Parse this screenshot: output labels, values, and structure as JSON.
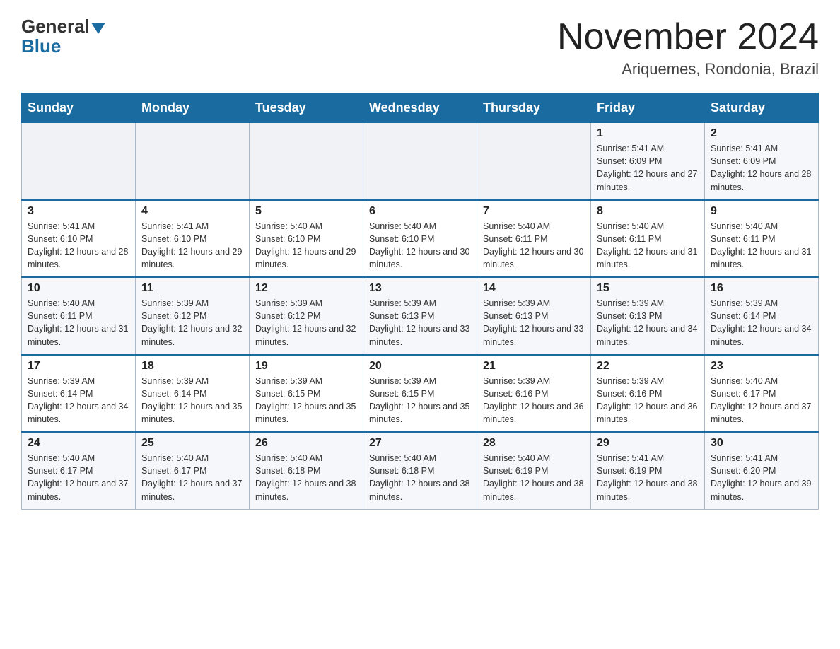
{
  "header": {
    "logo_general": "General",
    "logo_blue": "Blue",
    "title": "November 2024",
    "subtitle": "Ariquemes, Rondonia, Brazil"
  },
  "weekdays": [
    "Sunday",
    "Monday",
    "Tuesday",
    "Wednesday",
    "Thursday",
    "Friday",
    "Saturday"
  ],
  "weeks": [
    [
      {
        "day": "",
        "info": ""
      },
      {
        "day": "",
        "info": ""
      },
      {
        "day": "",
        "info": ""
      },
      {
        "day": "",
        "info": ""
      },
      {
        "day": "",
        "info": ""
      },
      {
        "day": "1",
        "info": "Sunrise: 5:41 AM\nSunset: 6:09 PM\nDaylight: 12 hours and 27 minutes."
      },
      {
        "day": "2",
        "info": "Sunrise: 5:41 AM\nSunset: 6:09 PM\nDaylight: 12 hours and 28 minutes."
      }
    ],
    [
      {
        "day": "3",
        "info": "Sunrise: 5:41 AM\nSunset: 6:10 PM\nDaylight: 12 hours and 28 minutes."
      },
      {
        "day": "4",
        "info": "Sunrise: 5:41 AM\nSunset: 6:10 PM\nDaylight: 12 hours and 29 minutes."
      },
      {
        "day": "5",
        "info": "Sunrise: 5:40 AM\nSunset: 6:10 PM\nDaylight: 12 hours and 29 minutes."
      },
      {
        "day": "6",
        "info": "Sunrise: 5:40 AM\nSunset: 6:10 PM\nDaylight: 12 hours and 30 minutes."
      },
      {
        "day": "7",
        "info": "Sunrise: 5:40 AM\nSunset: 6:11 PM\nDaylight: 12 hours and 30 minutes."
      },
      {
        "day": "8",
        "info": "Sunrise: 5:40 AM\nSunset: 6:11 PM\nDaylight: 12 hours and 31 minutes."
      },
      {
        "day": "9",
        "info": "Sunrise: 5:40 AM\nSunset: 6:11 PM\nDaylight: 12 hours and 31 minutes."
      }
    ],
    [
      {
        "day": "10",
        "info": "Sunrise: 5:40 AM\nSunset: 6:11 PM\nDaylight: 12 hours and 31 minutes."
      },
      {
        "day": "11",
        "info": "Sunrise: 5:39 AM\nSunset: 6:12 PM\nDaylight: 12 hours and 32 minutes."
      },
      {
        "day": "12",
        "info": "Sunrise: 5:39 AM\nSunset: 6:12 PM\nDaylight: 12 hours and 32 minutes."
      },
      {
        "day": "13",
        "info": "Sunrise: 5:39 AM\nSunset: 6:13 PM\nDaylight: 12 hours and 33 minutes."
      },
      {
        "day": "14",
        "info": "Sunrise: 5:39 AM\nSunset: 6:13 PM\nDaylight: 12 hours and 33 minutes."
      },
      {
        "day": "15",
        "info": "Sunrise: 5:39 AM\nSunset: 6:13 PM\nDaylight: 12 hours and 34 minutes."
      },
      {
        "day": "16",
        "info": "Sunrise: 5:39 AM\nSunset: 6:14 PM\nDaylight: 12 hours and 34 minutes."
      }
    ],
    [
      {
        "day": "17",
        "info": "Sunrise: 5:39 AM\nSunset: 6:14 PM\nDaylight: 12 hours and 34 minutes."
      },
      {
        "day": "18",
        "info": "Sunrise: 5:39 AM\nSunset: 6:14 PM\nDaylight: 12 hours and 35 minutes."
      },
      {
        "day": "19",
        "info": "Sunrise: 5:39 AM\nSunset: 6:15 PM\nDaylight: 12 hours and 35 minutes."
      },
      {
        "day": "20",
        "info": "Sunrise: 5:39 AM\nSunset: 6:15 PM\nDaylight: 12 hours and 35 minutes."
      },
      {
        "day": "21",
        "info": "Sunrise: 5:39 AM\nSunset: 6:16 PM\nDaylight: 12 hours and 36 minutes."
      },
      {
        "day": "22",
        "info": "Sunrise: 5:39 AM\nSunset: 6:16 PM\nDaylight: 12 hours and 36 minutes."
      },
      {
        "day": "23",
        "info": "Sunrise: 5:40 AM\nSunset: 6:17 PM\nDaylight: 12 hours and 37 minutes."
      }
    ],
    [
      {
        "day": "24",
        "info": "Sunrise: 5:40 AM\nSunset: 6:17 PM\nDaylight: 12 hours and 37 minutes."
      },
      {
        "day": "25",
        "info": "Sunrise: 5:40 AM\nSunset: 6:17 PM\nDaylight: 12 hours and 37 minutes."
      },
      {
        "day": "26",
        "info": "Sunrise: 5:40 AM\nSunset: 6:18 PM\nDaylight: 12 hours and 38 minutes."
      },
      {
        "day": "27",
        "info": "Sunrise: 5:40 AM\nSunset: 6:18 PM\nDaylight: 12 hours and 38 minutes."
      },
      {
        "day": "28",
        "info": "Sunrise: 5:40 AM\nSunset: 6:19 PM\nDaylight: 12 hours and 38 minutes."
      },
      {
        "day": "29",
        "info": "Sunrise: 5:41 AM\nSunset: 6:19 PM\nDaylight: 12 hours and 38 minutes."
      },
      {
        "day": "30",
        "info": "Sunrise: 5:41 AM\nSunset: 6:20 PM\nDaylight: 12 hours and 39 minutes."
      }
    ]
  ]
}
